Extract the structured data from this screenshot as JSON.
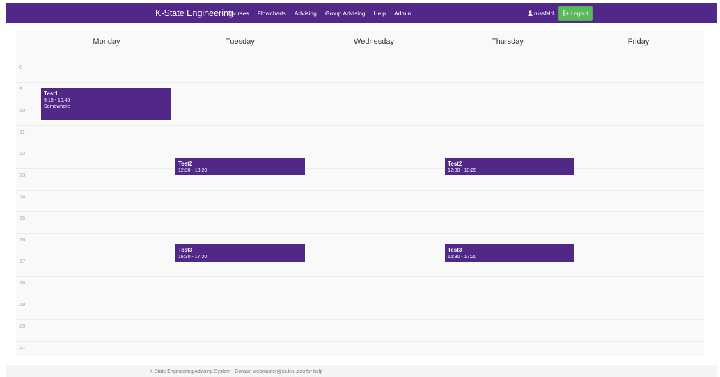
{
  "navbar": {
    "brand": "K-State Engineering",
    "links": [
      "Courses",
      "Flowcharts",
      "Advising",
      "Group Advising",
      "Help",
      "Admin"
    ],
    "user": "russfeld",
    "logout_label": "Logout"
  },
  "calendar": {
    "days": [
      "Monday",
      "Tuesday",
      "Wednesday",
      "Thursday",
      "Friday"
    ],
    "hours": [
      "8",
      "9",
      "10",
      "11",
      "12",
      "13",
      "14",
      "15",
      "16",
      "17",
      "18",
      "19",
      "20",
      "21"
    ],
    "events": [
      {
        "title": "Test1",
        "time": "9:15 - 10:45",
        "location": "Somewhere",
        "day": "Monday",
        "start": "9:15",
        "end": "10:45"
      },
      {
        "title": "Test2",
        "time": "12:30 - 13:20",
        "location": "",
        "day": "Tuesday",
        "start": "12:30",
        "end": "13:20"
      },
      {
        "title": "Test2",
        "time": "12:30 - 13:20",
        "location": "",
        "day": "Thursday",
        "start": "12:30",
        "end": "13:20"
      },
      {
        "title": "Test3",
        "time": "16:30 - 17:20",
        "location": "",
        "day": "Tuesday",
        "start": "16:30",
        "end": "17:20"
      },
      {
        "title": "Test3",
        "time": "16:30 - 17:20",
        "location": "",
        "day": "Thursday",
        "start": "16:30",
        "end": "17:20"
      }
    ]
  },
  "footer": {
    "text": "K-State Engineering Advising System - Contact webmaster@cs.ksu.edu for help"
  },
  "colors": {
    "primary": "#512888",
    "success": "#5cb85c",
    "calendar_bg": "#f9f9f9"
  },
  "icons": {
    "user": "user-icon",
    "logout": "sign-out-icon"
  }
}
